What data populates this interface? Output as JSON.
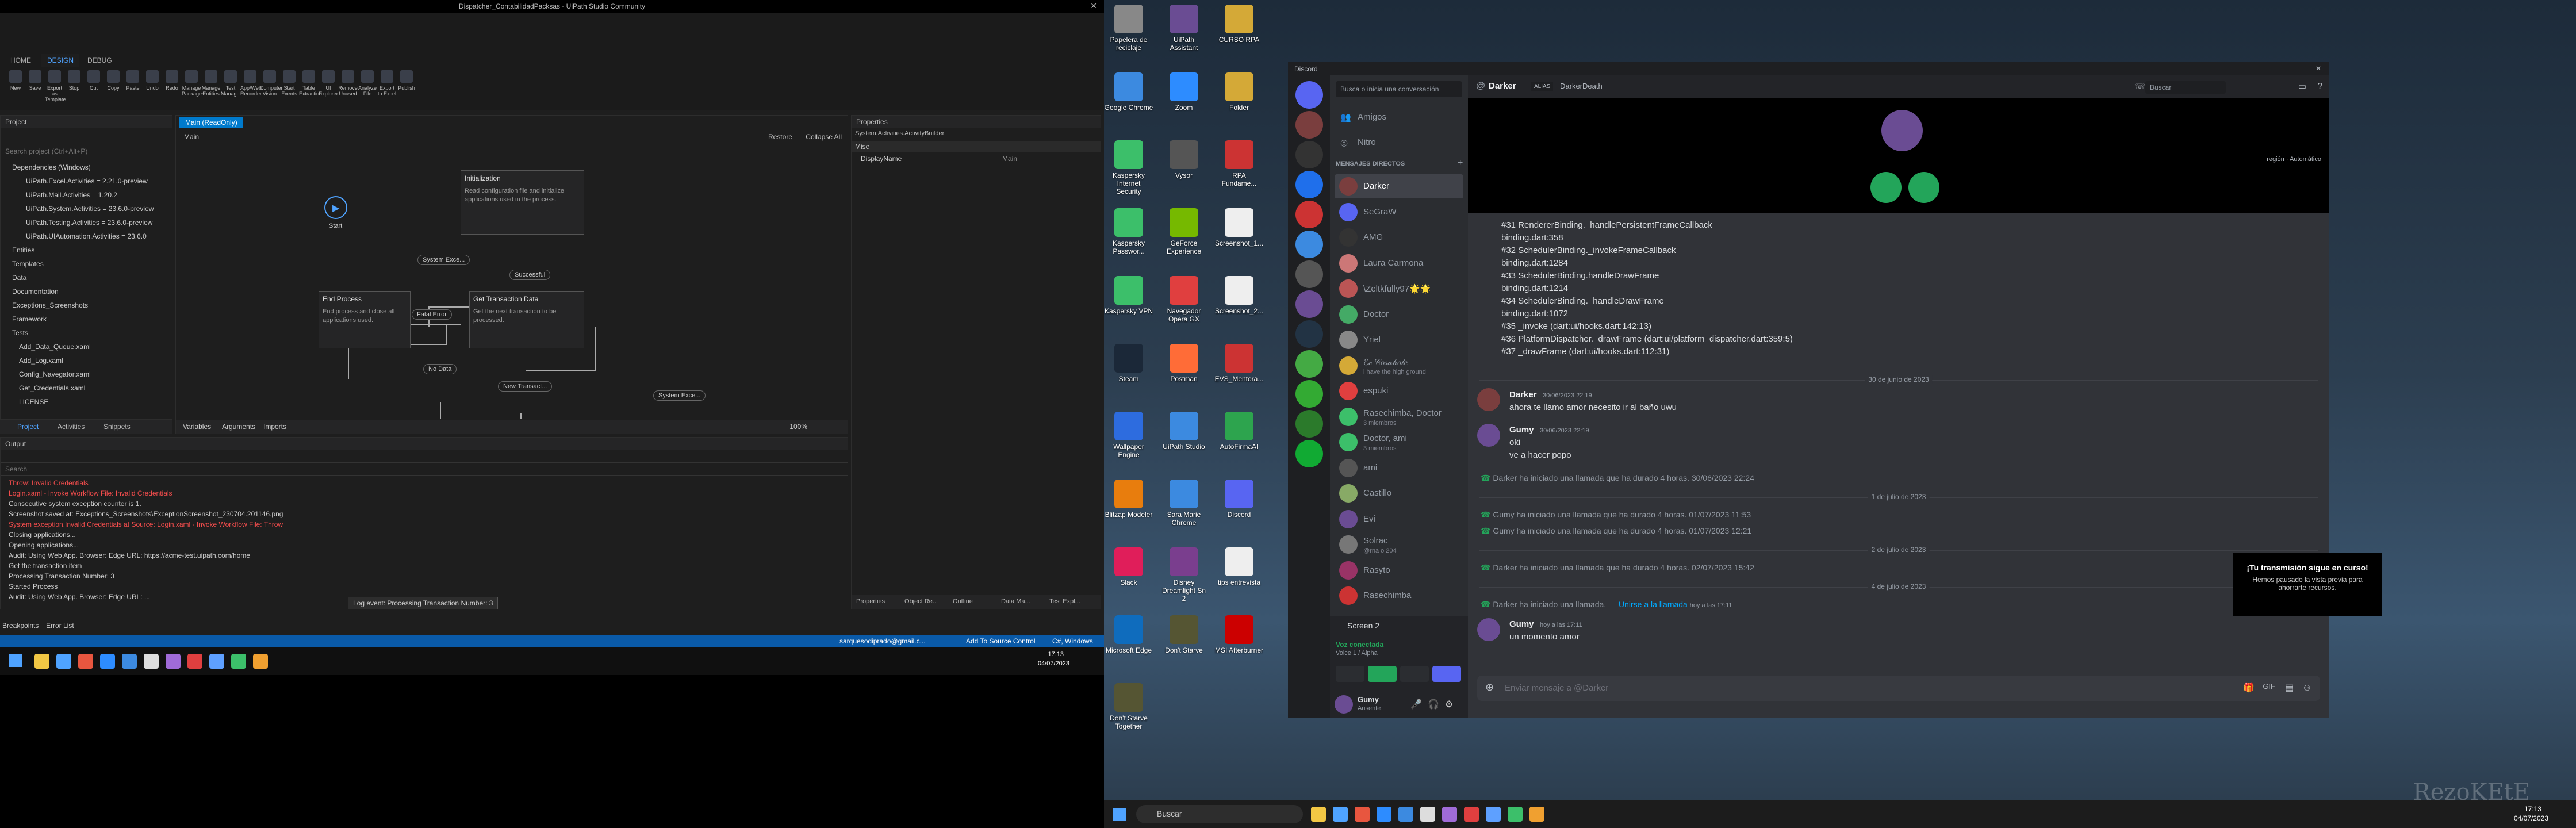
{
  "uipath": {
    "title": "Dispatcher_ContabilidadPacksas - UiPath Studio Community",
    "tabs": [
      "HOME",
      "DESIGN",
      "DEBUG"
    ],
    "ribbon": [
      "New",
      "Save",
      "Export as Template",
      "Stop",
      "Cut",
      "Copy",
      "Paste",
      "Undo",
      "Redo",
      "Manage Packages",
      "Manage Entities",
      "Test Manager",
      "App/Web Recorder",
      "Computer Vision",
      "Start Events",
      "Table Extraction",
      "UI Explorer",
      "Remove Unused",
      "Analyze File",
      "Export to Excel",
      "Publish"
    ],
    "project_title": "Project",
    "search_placeholder": "Search project (Ctrl+Alt+P)",
    "tree": [
      "Dependencies (Windows)",
      "UiPath.Excel.Activities = 2.21.0-preview",
      "UiPath.Mail.Activities = 1.20.2",
      "UiPath.System.Activities = 23.6.0-preview",
      "UiPath.Testing.Activities = 23.6.0-preview",
      "UiPath.UIAutomation.Activities = 23.6.0",
      "Entities",
      "Templates",
      "Data",
      "Documentation",
      "Exceptions_Screenshots",
      "Framework",
      "Tests",
      "Add_Data_Queue.xaml",
      "Add_Log.xaml",
      "Config_Navegator.xaml",
      "Get_Credentials.xaml",
      "LICENSE"
    ],
    "doc_tab": "Main (ReadOnly)",
    "doc_header": "Main",
    "restore": "Restore",
    "collapse": "Collapse All",
    "nodes": {
      "init_title": "Initialization",
      "init_desc": "Read configuration file and initialize applications used in the process.",
      "end_title": "End Process",
      "end_desc": "End process and close all applications used.",
      "get_title": "Get Transaction Data",
      "get_desc": "Get the next transaction to be processed.",
      "start": "Start"
    },
    "edges": [
      "System Exce...",
      "Successful",
      "Fatal Error",
      "No Data",
      "New Transact...",
      "System Exce..."
    ],
    "bottom_tabs": [
      "Variables",
      "Arguments",
      "Imports"
    ],
    "zoom": "100%",
    "properties_title": "Properties",
    "properties_type": "System.Activities.ActivityBuilder",
    "properties_misc": "Misc",
    "properties_name_key": "DisplayName",
    "properties_name_val": "Main",
    "output_title": "Output",
    "output_search": "Search",
    "output_lines": [
      {
        "t": "Throw: Invalid Credentials",
        "c": "#f14c4c"
      },
      {
        "t": "Login.xaml - Invoke Workflow File: Invalid Credentials",
        "c": "#f14c4c"
      },
      {
        "t": "Consecutive system exception counter is 1.",
        "c": "#ccc"
      },
      {
        "t": "Screenshot saved at: Exceptions_Screenshots\\ExceptionScreenshot_230704.201146.png",
        "c": "#ccc"
      },
      {
        "t": "System exception.Invalid Credentials at Source: Login.xaml - Invoke Workflow File: Throw",
        "c": "#f14c4c"
      },
      {
        "t": "Closing applications...",
        "c": "#ccc"
      },
      {
        "t": "Opening applications...",
        "c": "#ccc"
      },
      {
        "t": "Audit: Using Web App. Browser: Edge URL: https://acme-test.uipath.com/home",
        "c": "#ccc"
      },
      {
        "t": "Get the transaction item",
        "c": "#ccc"
      },
      {
        "t": "Processing Transaction Number: 3",
        "c": "#ccc"
      },
      {
        "t": "Started Process",
        "c": "#ccc"
      },
      {
        "t": "Audit: Using Web App. Browser: Edge URL: ...",
        "c": "#ccc"
      }
    ],
    "tooltip": "Log event: Processing Transaction Number: 3",
    "side_tabs": [
      "Properties",
      "Object Re...",
      "Outline",
      "Data Ma...",
      "Test Expl..."
    ],
    "breakpoints": "Breakpoints",
    "error_list": "Error List",
    "status_user": "sarquesodiprado@gmail.c...",
    "status_source": "Add To Source Control",
    "status_cl": "C#, Windows",
    "clock_time": "17:13",
    "clock_date": "04/07/2023"
  },
  "desktop": {
    "icons": [
      "Papelera de reciclaje",
      "UiPath Assistant",
      "CURSO RPA",
      "Google Chrome",
      "Zoom",
      "Folder",
      "Kaspersky Internet Security",
      "Vysor",
      "RPA Fundame...",
      "Kaspersky Passwor...",
      "GeForce Experience",
      "Screenshot_1...",
      "Kaspersky VPN",
      "Navegador Opera GX",
      "Screenshot_2...",
      "Steam",
      "Postman",
      "EVS_Mentora...",
      "Wallpaper Engine",
      "UiPath Studio",
      "AutoFirmaAI",
      "Blitzap Modeler",
      "Sara Marie Chrome",
      "Discord",
      "Slack",
      "Disney Dreamlight Sn 2",
      "tips entrevista",
      "Microsoft Edge",
      "Don't Starve",
      "MSI Afterburner",
      "Don't Starve Together"
    ],
    "search": "Buscar",
    "clock_time": "17:13",
    "clock_date": "04/07/2023",
    "watermark": "RezoKEtE"
  },
  "discord": {
    "app_name": "Discord",
    "search_conv": "Busca o inicia una conversación",
    "friends": "Amigos",
    "nitro": "Nitro",
    "dm_header": "MENSAJES DIRECTOS",
    "dms": [
      {
        "n": "Darker",
        "s": ""
      },
      {
        "n": "SeGraW",
        "s": ""
      },
      {
        "n": "AMG",
        "s": ""
      },
      {
        "n": "Laura Carmona",
        "s": ""
      },
      {
        "n": "\\Zeltkfully97🌟🌟",
        "s": ""
      },
      {
        "n": "Doctor",
        "s": ""
      },
      {
        "n": "Yriel",
        "s": ""
      },
      {
        "n": "ℰ𝒸 𝒞𝑜𝓈𝒶𝒽𝑜𝓉𝑒",
        "s": "i have the high ground"
      },
      {
        "n": "espuki",
        "s": ""
      },
      {
        "n": "Rasechimba, Doctor",
        "s": "3 miembros"
      },
      {
        "n": "Doctor, ami",
        "s": "3 miembros"
      },
      {
        "n": "ami",
        "s": ""
      },
      {
        "n": "Castillo",
        "s": ""
      },
      {
        "n": "Evi",
        "s": ""
      },
      {
        "n": "Solrac",
        "s": "@rna o 204"
      },
      {
        "n": "Rasyto",
        "s": ""
      },
      {
        "n": "Rasechimba",
        "s": ""
      }
    ],
    "screen_label": "Screen 2",
    "voice_connected": "Voz conectada",
    "voice_sub": "Voice 1 / Alpha",
    "user_name": "Gumy",
    "user_status": "Ausente",
    "chat_name": "Darker",
    "alias_tag": "ALIAS",
    "alias": "DarkerDeath",
    "search": "Buscar",
    "region": "región",
    "region_val": "Automático",
    "code_lines": [
      "#31    RendererBinding._handlePersistentFrameCallback",
      "binding.dart:358",
      "#32    SchedulerBinding._invokeFrameCallback",
      "binding.dart:1284",
      "#33    SchedulerBinding.handleDrawFrame",
      "binding.dart:1214",
      "#34    SchedulerBinding._handleDrawFrame",
      "binding.dart:1072",
      "#35    _invoke (dart:ui/hooks.dart:142:13)",
      "#36    PlatformDispatcher._drawFrame (dart:ui/platform_dispatcher.dart:359:5)",
      "#37    _drawFrame (dart:ui/hooks.dart:112:31)"
    ],
    "div1": "30 de junio de 2023",
    "m1_name": "Darker",
    "m1_time": "30/06/2023 22:19",
    "m1_text": "ahora te llamo amor necesito ir al baño uwu",
    "m2_name": "Gumy",
    "m2_time": "30/06/2023 22:19",
    "m2_text1": "oki",
    "m2_text2": "ve a hacer popo",
    "c1": "Darker ha iniciado una llamada que ha durado 4 horas. 30/06/2023 22:24",
    "div2": "1 de julio de 2023",
    "c2": "Gumy ha iniciado una llamada que ha durado 4 horas. 01/07/2023 11:53",
    "c3": "Gumy ha iniciado una llamada que ha durado 4 horas. 01/07/2023 12:21",
    "div3": "2 de julio de 2023",
    "c4": "Darker ha iniciado una llamada que ha durado 4 horas. 02/07/2023 15:42",
    "div4": "4 de julio de 2023",
    "c5a": "Darker ha iniciado una llamada.",
    "c5b": "— Unirse a la llamada",
    "c5c": "hoy a las 17:11",
    "m3_name": "Gumy",
    "m3_time": "hoy a las 17:11",
    "m3_text": "un momento amor",
    "stream_title": "¡Tu transmisión sigue en curso!",
    "stream_desc": "Hemos pausado la vista previa para ahorrarte recursos.",
    "input_placeholder": "Enviar mensaje a @Darker"
  }
}
